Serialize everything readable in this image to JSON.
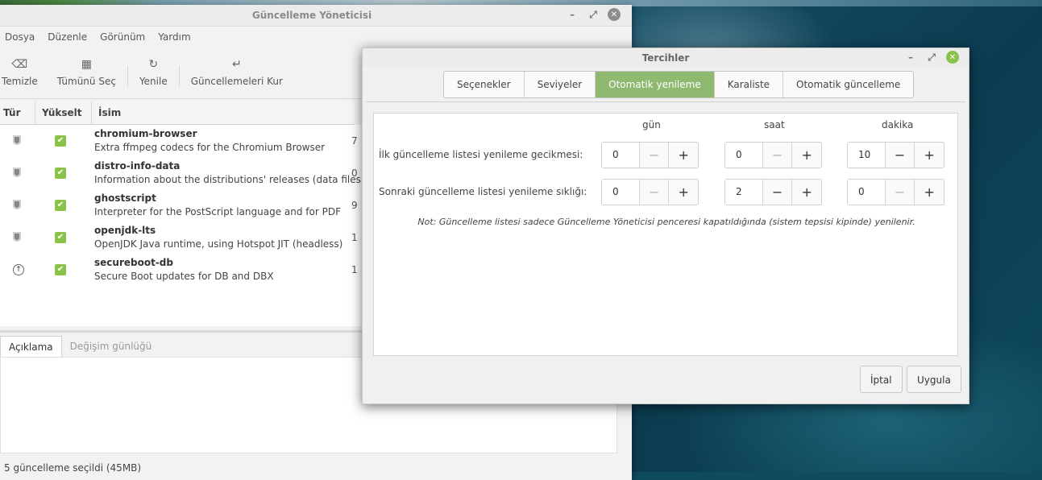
{
  "main_window": {
    "title": "Güncelleme Yöneticisi",
    "menu": [
      "Dosya",
      "Düzenle",
      "Görünüm",
      "Yardım"
    ],
    "toolbar": {
      "clear": "Temizle",
      "select_all": "Tümünü Seç",
      "refresh": "Yenile",
      "install": "Güncellemeleri Kur"
    },
    "columns": {
      "type": "Tür",
      "upgrade": "Yükselt",
      "name": "İsim"
    },
    "updates": [
      {
        "name": "chromium-browser",
        "desc": "Extra ffmpeg codecs for the Chromium Browser",
        "icon": "shield-icon",
        "extra": "7"
      },
      {
        "name": "distro-info-data",
        "desc": "Information about the distributions' releases (data files)",
        "icon": "shield-icon",
        "extra": "0"
      },
      {
        "name": "ghostscript",
        "desc": "Interpreter for the PostScript language and for PDF",
        "icon": "shield-icon",
        "extra": "9"
      },
      {
        "name": "openjdk-lts",
        "desc": "OpenJDK Java runtime, using Hotspot JIT (headless)",
        "icon": "shield-icon",
        "extra": "1"
      },
      {
        "name": "secureboot-db",
        "desc": "Secure Boot updates for DB and DBX",
        "icon": "arrow-up-circle-icon",
        "extra": "1"
      }
    ],
    "lower_tabs": {
      "description": "Açıklama",
      "changelog": "Değişim günlüğü"
    },
    "status": "5 güncelleme seçildi (45MB)"
  },
  "preferences": {
    "title": "Tercihler",
    "tabs": [
      "Seçenekler",
      "Seviyeler",
      "Otomatik yenileme",
      "Karaliste",
      "Otomatik güncelleme"
    ],
    "active_tab": "Otomatik yenileme",
    "columns": {
      "days": "gün",
      "hours": "saat",
      "minutes": "dakika"
    },
    "rows": [
      {
        "label": "İlk güncelleme listesi yenileme gecikmesi:",
        "days": "0",
        "hours": "0",
        "minutes": "10"
      },
      {
        "label": "Sonraki güncelleme listesi yenileme sıklığı:",
        "days": "0",
        "hours": "2",
        "minutes": "0"
      }
    ],
    "note": "Not: Güncelleme listesi sadece Güncelleme Yöneticisi penceresi kapatıldığında (sistem tepsisi kipinde) yenilenir.",
    "cancel": "İptal",
    "apply": "Uygula"
  }
}
